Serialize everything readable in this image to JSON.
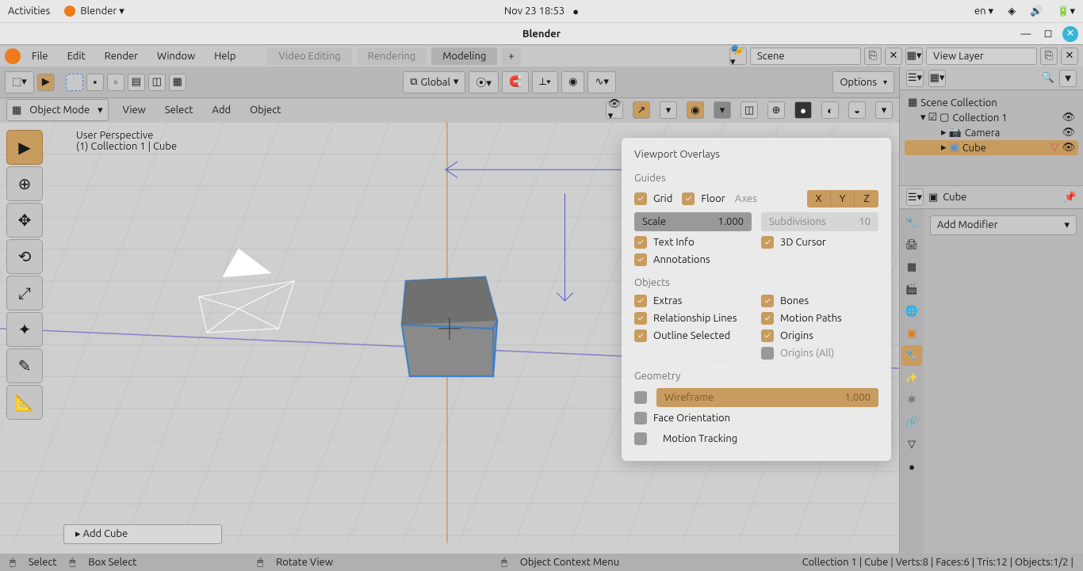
{
  "system": {
    "activities": "Activities",
    "app_menu": "Blender",
    "datetime": "Nov 23  18:53",
    "lang": "en"
  },
  "window": {
    "title": "Blender"
  },
  "top_menu": {
    "file": "File",
    "edit": "Edit",
    "render": "Render",
    "window": "Window",
    "help": "Help"
  },
  "workspace_tabs": {
    "video": "Video Editing",
    "rendering": "Rendering",
    "modeling": "Modeling"
  },
  "scene": {
    "scene_label": "Scene",
    "view_layer": "View Layer"
  },
  "viewport_header": {
    "mode": "Object Mode",
    "menus": {
      "view": "View",
      "select": "Select",
      "add": "Add",
      "object": "Object"
    },
    "orientation": "Global",
    "options": "Options"
  },
  "viewport": {
    "perspective": "User Perspective",
    "collection_path": "(1) Collection 1 | Cube",
    "add_cube": "Add Cube"
  },
  "overlays": {
    "title": "Viewport Overlays",
    "guides_label": "Guides",
    "grid": "Grid",
    "floor": "Floor",
    "axes": "Axes",
    "axis_x": "X",
    "axis_y": "Y",
    "axis_z": "Z",
    "scale_label": "Scale",
    "scale_value": "1.000",
    "subdiv_label": "Subdivisions",
    "subdiv_value": "10",
    "text_info": "Text Info",
    "cursor3d": "3D Cursor",
    "annotations": "Annotations",
    "objects_label": "Objects",
    "extras": "Extras",
    "bones": "Bones",
    "relationship": "Relationship Lines",
    "motion_paths": "Motion Paths",
    "outline_selected": "Outline Selected",
    "origins": "Origins",
    "origins_all": "Origins (All)",
    "geometry_label": "Geometry",
    "wireframe": "Wireframe",
    "wireframe_val": "1.000",
    "face_orientation": "Face Orientation",
    "motion_tracking": "Motion Tracking"
  },
  "outliner": {
    "scene_collection": "Scene Collection",
    "collection1": "Collection 1",
    "camera": "Camera",
    "cube": "Cube"
  },
  "properties": {
    "object_name": "Cube",
    "add_modifier": "Add Modifier"
  },
  "status": {
    "select": "Select",
    "box_select": "Box Select",
    "rotate": "Rotate View",
    "context_menu": "Object Context Menu",
    "info": "Collection 1 | Cube | Verts:8 | Faces:6 | Tris:12 | Objects:1/2 |"
  }
}
